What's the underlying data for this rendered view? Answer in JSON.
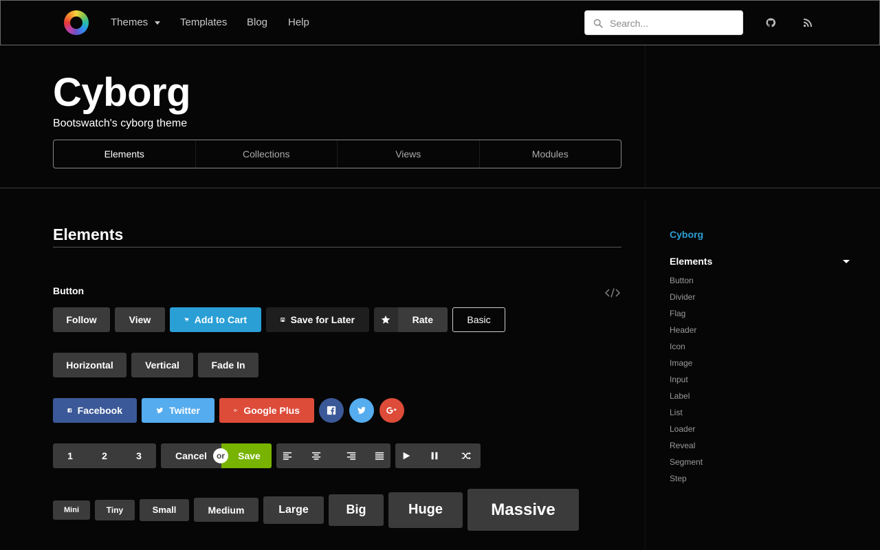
{
  "nav": {
    "logo": "bootswatch-logo",
    "items": [
      "Themes",
      "Templates",
      "Blog",
      "Help"
    ],
    "search_placeholder": "Search...",
    "icons": [
      "github-icon",
      "rss-icon"
    ]
  },
  "hero": {
    "title": "Cyborg",
    "subtitle": "Bootswatch's cyborg theme",
    "tabs": [
      "Elements",
      "Collections",
      "Views",
      "Modules"
    ],
    "active_tab": "Elements"
  },
  "section": {
    "title": "Elements",
    "subtitle": "Button"
  },
  "buttons": {
    "row1": {
      "follow": "Follow",
      "view": "View",
      "add_to_cart": "Add to Cart",
      "save_for_later": "Save for Later",
      "rate": "Rate",
      "basic": "Basic"
    },
    "row2": {
      "horizontal": "Horizontal",
      "vertical": "Vertical",
      "fade_in": "Fade In"
    },
    "row3": {
      "facebook": "Facebook",
      "twitter": "Twitter",
      "google_plus": "Google Plus"
    },
    "row4": {
      "numbers": [
        "1",
        "2",
        "3"
      ],
      "cancel": "Cancel",
      "or": "or",
      "save": "Save"
    },
    "sizes": [
      "Mini",
      "Tiny",
      "Small",
      "Medium",
      "Large",
      "Big",
      "Huge",
      "Massive"
    ]
  },
  "sidebar": {
    "brand": "Cyborg",
    "heading": "Elements",
    "items": [
      "Button",
      "Divider",
      "Flag",
      "Header",
      "Icon",
      "Image",
      "Input",
      "Label",
      "List",
      "Loader",
      "Reveal",
      "Segment",
      "Step"
    ]
  },
  "colors": {
    "background": "#060606",
    "accent_blue": "#2a9fd6",
    "button_grey": "#3b3b3b",
    "facebook": "#3b5998",
    "twitter": "#55acee",
    "google_plus": "#dd4b39",
    "save_green": "#77b300"
  }
}
